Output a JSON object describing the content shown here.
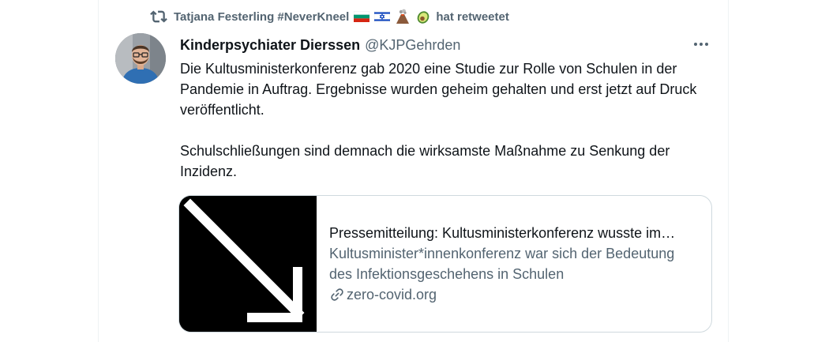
{
  "retweet": {
    "text": "Tatjana Festerling #NeverKneel",
    "suffix": "hat retweetet",
    "icons": [
      "bulgaria-flag-icon",
      "israel-flag-icon",
      "volcano-icon",
      "avocado-icon"
    ]
  },
  "tweet": {
    "display_name": "Kinderpsychiater Dierssen",
    "handle": "@KJPGehrden",
    "paragraphs": [
      "Die Kultusministerkonferenz gab 2020 eine Studie zur Rolle von Schulen in der Pandemie in Auftrag. Ergebnisse wurden geheim gehalten und erst jetzt auf Druck veröffentlicht.",
      "Schulschließungen sind demnach die wirksamste Maßnahme zu Senkung der Inzidenz."
    ]
  },
  "card": {
    "title": "Pressemitteilung: Kultusministerkonferenz wusste im…",
    "description": "Kultusminister*innenkonferenz war sich der Bedeutung des Infektionsgeschehens in Schulen",
    "domain": "zero-covid.org",
    "thumb_icon": "diagonal-arrow-icon"
  },
  "colors": {
    "text_primary": "#0f1419",
    "text_secondary": "#536471",
    "border": "#cfd9de"
  }
}
